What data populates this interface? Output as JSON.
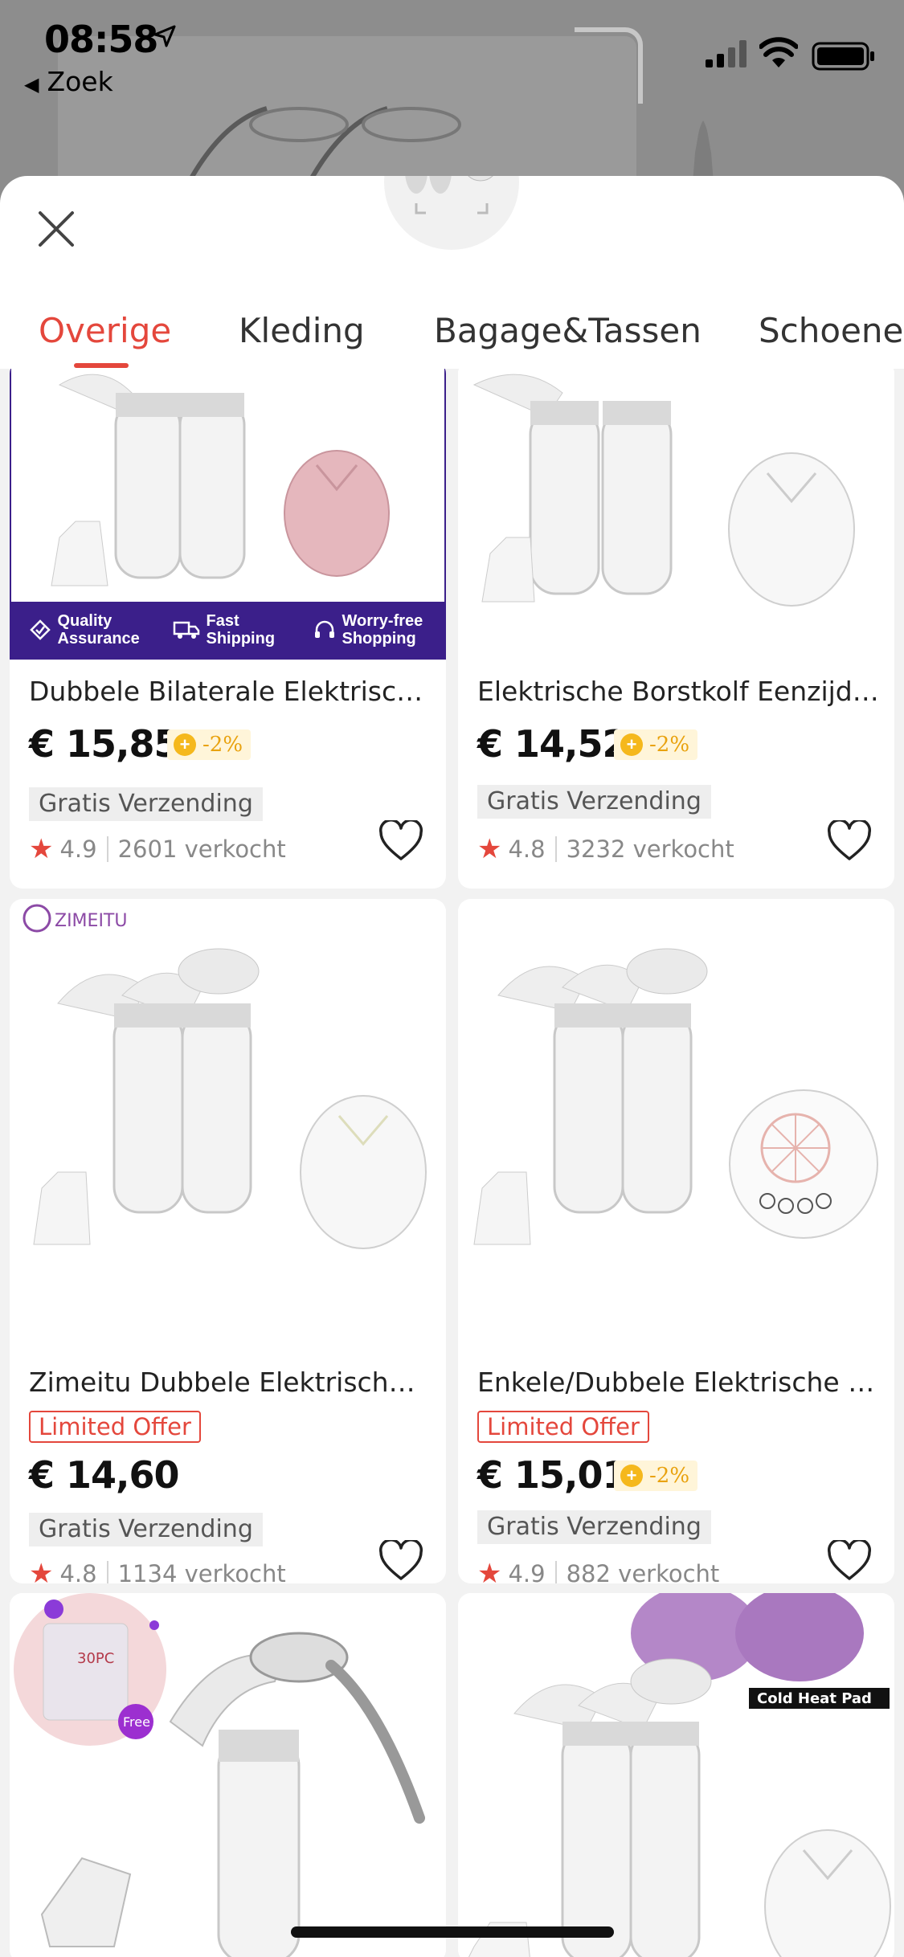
{
  "status_bar": {
    "time": "08:58",
    "back_label": "Zoek"
  },
  "tabs": [
    {
      "label": "Overige",
      "active": true
    },
    {
      "label": "Kleding",
      "active": false
    },
    {
      "label": "Bagage&Tassen",
      "active": false
    },
    {
      "label": "Schoenen",
      "active": false
    }
  ],
  "badges": {
    "quality": "Quality Assurance",
    "shipping": "Fast Shipping",
    "worry": "Worry-free Shopping"
  },
  "products": [
    {
      "title": "Dubbele Bilaterale Elektrische Borstkolf",
      "price": "€ 15,85",
      "discount": "-2%",
      "shipping": "Gratis Verzending",
      "rating": "4.9",
      "sold": "2601 verkocht"
    },
    {
      "title": "Elektrische Borstkolf Eenzijdige Borstkolf",
      "price": "€ 14,52",
      "discount": "-2%",
      "shipping": "Gratis Verzending",
      "rating": "4.8",
      "sold": "3232 verkocht"
    },
    {
      "title": "Zimeitu Dubbele Elektrische Borstkolf",
      "brand": "ZIMEITU",
      "limited": "Limited Offer",
      "price": "€ 14,60",
      "shipping": "Gratis Verzending",
      "rating": "4.8",
      "sold": "1134 verkocht"
    },
    {
      "title": "Enkele/Dubbele Elektrische Borstkolf",
      "limited": "Limited Offer",
      "price": "€ 15,01",
      "discount": "-2%",
      "shipping": "Gratis Verzending",
      "rating": "4.9",
      "sold": "882 verkocht"
    },
    {
      "title": "",
      "overlay_text": "30PC",
      "overlay_badge": "Free"
    },
    {
      "title": "",
      "overlay_text": "Cold Heat Pad"
    }
  ],
  "colors": {
    "accent": "#e4473c",
    "coin": "#f5b81c",
    "badge_strip": "#3b1f8a"
  }
}
